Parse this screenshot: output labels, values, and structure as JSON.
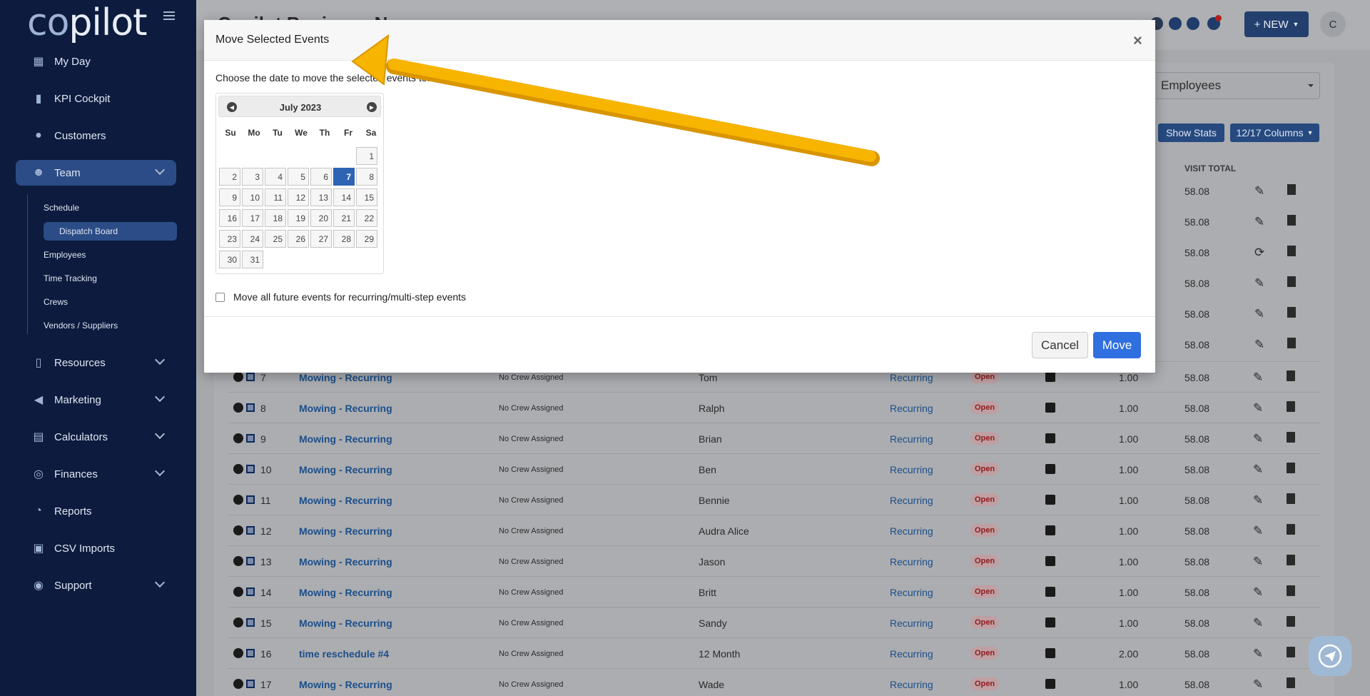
{
  "app": {
    "logo_a": "co",
    "logo_b": "p",
    "logo_c": "ilot",
    "page_title": "Copilot Business Na"
  },
  "sidebar": {
    "items": [
      {
        "label": "My Day",
        "icon": "grid-icon"
      },
      {
        "label": "KPI Cockpit",
        "icon": "bar-chart-icon"
      },
      {
        "label": "Customers",
        "icon": "users-icon"
      },
      {
        "label": "Team",
        "icon": "team-icon"
      },
      {
        "label": "Resources",
        "icon": "book-icon"
      },
      {
        "label": "Marketing",
        "icon": "megaphone-icon"
      },
      {
        "label": "Calculators",
        "icon": "calculator-icon"
      },
      {
        "label": "Finances",
        "icon": "money-icon"
      },
      {
        "label": "Reports",
        "icon": "pie-chart-icon"
      },
      {
        "label": "CSV Imports",
        "icon": "file-csv-icon"
      },
      {
        "label": "Support",
        "icon": "life-ring-icon"
      }
    ],
    "team_sub": [
      "Schedule",
      "Dispatch Board",
      "Employees",
      "Time Tracking",
      "Crews",
      "Vendors / Suppliers"
    ]
  },
  "header": {
    "new_label": "+ NEW",
    "avatar_initial": "C"
  },
  "toolbar": {
    "employee_filter": "Employees",
    "show_stats": "Show Stats",
    "columns": "12/17 Columns",
    "visit_total_header": "VISIT TOTAL"
  },
  "bg_rows_top": [
    {
      "total": "58.08",
      "action": "edit"
    },
    {
      "total": "58.08",
      "action": "edit"
    },
    {
      "total": "58.08",
      "action": "refresh"
    },
    {
      "total": "58.08",
      "action": "edit"
    },
    {
      "total": "58.08",
      "action": "edit"
    },
    {
      "total": "58.08",
      "action": "edit"
    }
  ],
  "rows": [
    {
      "num": "7",
      "job": "Mowing - Recurring",
      "crew": "No Crew Assigned",
      "employee": "Tom",
      "type": "Recurring",
      "status": "Open",
      "qty": "1.00",
      "total": "58.08"
    },
    {
      "num": "8",
      "job": "Mowing - Recurring",
      "crew": "No Crew Assigned",
      "employee": "Ralph",
      "type": "Recurring",
      "status": "Open",
      "qty": "1.00",
      "total": "58.08"
    },
    {
      "num": "9",
      "job": "Mowing - Recurring",
      "crew": "No Crew Assigned",
      "employee": "Brian",
      "type": "Recurring",
      "status": "Open",
      "qty": "1.00",
      "total": "58.08"
    },
    {
      "num": "10",
      "job": "Mowing - Recurring",
      "crew": "No Crew Assigned",
      "employee": "Ben",
      "type": "Recurring",
      "status": "Open",
      "qty": "1.00",
      "total": "58.08"
    },
    {
      "num": "11",
      "job": "Mowing - Recurring",
      "crew": "No Crew Assigned",
      "employee": "Bennie",
      "type": "Recurring",
      "status": "Open",
      "qty": "1.00",
      "total": "58.08"
    },
    {
      "num": "12",
      "job": "Mowing - Recurring",
      "crew": "No Crew Assigned",
      "employee": "Audra Alice",
      "type": "Recurring",
      "status": "Open",
      "qty": "1.00",
      "total": "58.08"
    },
    {
      "num": "13",
      "job": "Mowing - Recurring",
      "crew": "No Crew Assigned",
      "employee": "Jason",
      "type": "Recurring",
      "status": "Open",
      "qty": "1.00",
      "total": "58.08"
    },
    {
      "num": "14",
      "job": "Mowing - Recurring",
      "crew": "No Crew Assigned",
      "employee": "Britt",
      "type": "Recurring",
      "status": "Open",
      "qty": "1.00",
      "total": "58.08"
    },
    {
      "num": "15",
      "job": "Mowing - Recurring",
      "crew": "No Crew Assigned",
      "employee": "Sandy",
      "type": "Recurring",
      "status": "Open",
      "qty": "1.00",
      "total": "58.08"
    },
    {
      "num": "16",
      "job": "time reschedule #4",
      "crew": "No Crew Assigned",
      "employee": "12 Month",
      "type": "Recurring",
      "status": "Open",
      "qty": "2.00",
      "total": "58.08"
    },
    {
      "num": "17",
      "job": "Mowing - Recurring",
      "crew": "No Crew Assigned",
      "employee": "Wade",
      "type": "Recurring",
      "status": "Open",
      "qty": "1.00",
      "total": "58.08"
    }
  ],
  "modal": {
    "title": "Move Selected Events",
    "close": "×",
    "prompt": "Choose the date to move the selected events to:",
    "month_label": "July 2023",
    "prev_icon": "chevron-left-icon",
    "next_icon": "chevron-right-icon",
    "weekdays": [
      "Su",
      "Mo",
      "Tu",
      "We",
      "Th",
      "Fr",
      "Sa"
    ],
    "first_weekday_index": 6,
    "days_in_month": 31,
    "selected_day": 7,
    "future_label": "Move all future events for recurring/multi-step events",
    "cancel_label": "Cancel",
    "move_label": "Move"
  },
  "colors": {
    "sidebar_bg": "#0d1b3e",
    "accent": "#2f6fe0",
    "arrow": "#f5b300",
    "selected_day": "#2f64b5",
    "status_open": "#8e1d1d"
  }
}
